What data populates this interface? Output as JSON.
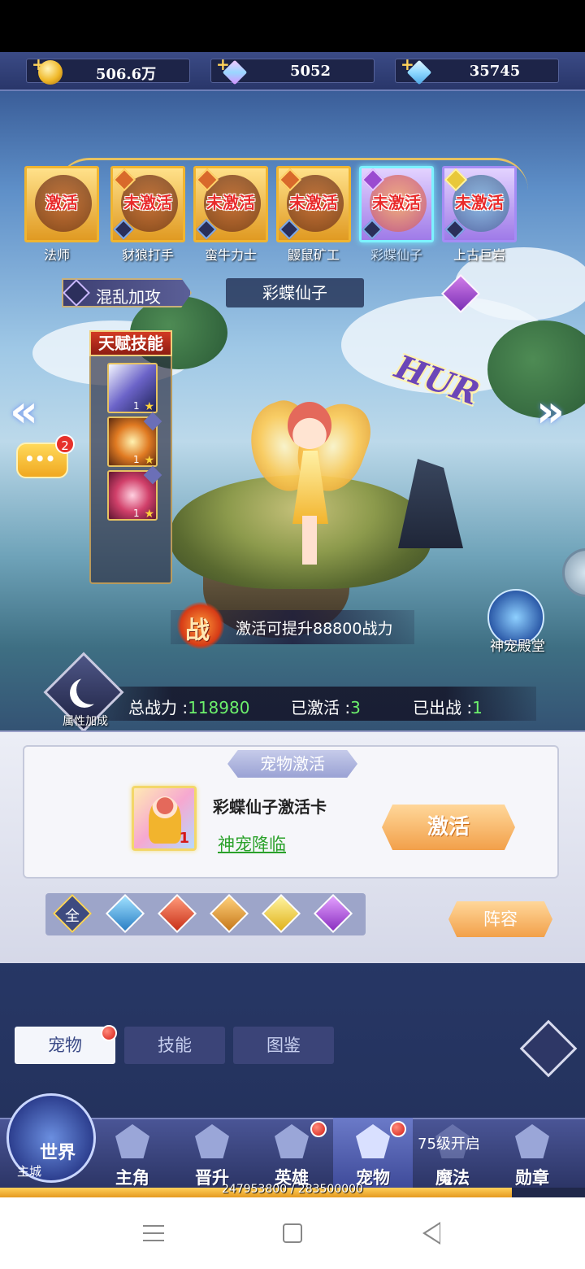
{
  "currency": [
    {
      "icon": "gold-coin-icon",
      "value": "506.6万"
    },
    {
      "icon": "crystal-icon",
      "value": "5052"
    },
    {
      "icon": "diamond-icon",
      "value": "35745"
    }
  ],
  "pets": [
    {
      "state": "激活",
      "name": "法师"
    },
    {
      "state": "未激活",
      "name": "豺狼打手"
    },
    {
      "state": "未激活",
      "name": "蛮牛力士"
    },
    {
      "state": "未激活",
      "name": "鼹鼠矿工"
    },
    {
      "state": "未激活",
      "name": "彩蝶仙子"
    },
    {
      "state": "未激活",
      "name": "上古巨岩"
    }
  ],
  "skill": {
    "name": "混乱加攻"
  },
  "selected_pet": {
    "name": "彩蝶仙子"
  },
  "talent": {
    "title": "天赋技能",
    "skills": [
      {
        "level": "1"
      },
      {
        "level": "1"
      },
      {
        "level": "1"
      }
    ]
  },
  "chat": {
    "badge": "2"
  },
  "battle": {
    "icon_char": "战",
    "message": "激活可提升88800战力"
  },
  "shrine": {
    "label": "神宠殿堂"
  },
  "stats": {
    "attr_label": "属性加成",
    "total_power_label": "总战力 :",
    "total_power_value": "118980",
    "activated_label": "已激活 :",
    "activated_value": "3",
    "deployed_label": "已出战 :",
    "deployed_value": "1"
  },
  "activation": {
    "title": "宠物激活",
    "card_count": "1",
    "card_name": "彩蝶仙子激活卡",
    "link": "神宠降临",
    "button": "激活"
  },
  "filters": {
    "all_label": "全"
  },
  "lineup_button": "阵容",
  "tabs": [
    {
      "label": "宠物"
    },
    {
      "label": "技能"
    },
    {
      "label": "图鉴"
    }
  ],
  "nav": {
    "world": "世界",
    "main_city": "主城",
    "items": [
      {
        "label": "主角"
      },
      {
        "label": "晋升"
      },
      {
        "label": "英雄"
      },
      {
        "label": "宠物"
      },
      {
        "label": "魔法"
      },
      {
        "label": "勋章"
      }
    ],
    "magic_lock": "75级开启"
  },
  "xp": {
    "text": "247953800 / 283500000",
    "fraction": 0.8745
  },
  "colors": {
    "accent": "#f2a04a",
    "positive": "#6cf06c",
    "link": "#2aa12a"
  }
}
